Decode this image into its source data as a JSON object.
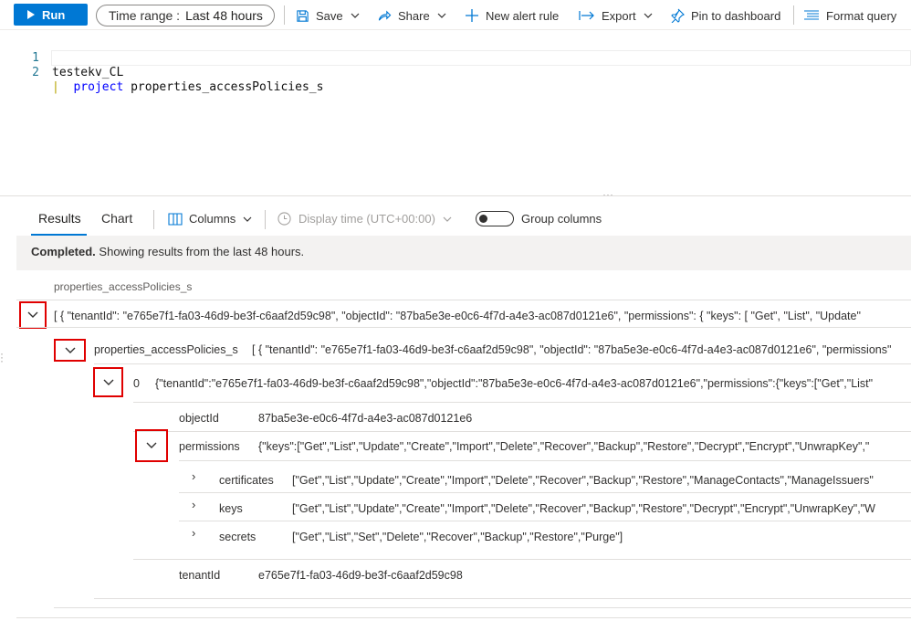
{
  "toolbar": {
    "run_label": "Run",
    "time_range_label": "Time range :",
    "time_range_value": "Last 48 hours",
    "save_label": "Save",
    "share_label": "Share",
    "new_alert_label": "New alert rule",
    "export_label": "Export",
    "pin_label": "Pin to dashboard",
    "format_label": "Format query"
  },
  "editor": {
    "lines": [
      {
        "number": "1",
        "text": "testekv_CL"
      },
      {
        "number": "2",
        "pipe": "|",
        "keyword": "project",
        "text": "properties_accessPolicies_s"
      }
    ]
  },
  "results": {
    "tabs": [
      "Results",
      "Chart"
    ],
    "columns_label": "Columns",
    "display_time_label": "Display time (UTC+00:00)",
    "group_columns_label": "Group columns",
    "status_bold": "Completed.",
    "status_text": "Showing results from the last 48 hours.",
    "column_header": "properties_accessPolicies_s",
    "row_value": "[ { \"tenantId\": \"e765e7f1-fa03-46d9-be3f-c6aaf2d59c98\", \"objectId\": \"87ba5e3e-e0c6-4f7d-a4e3-ac087d0121e6\", \"permissions\": { \"keys\": [ \"Get\", \"List\", \"Update\"",
    "level1": {
      "name": "properties_accessPolicies_s",
      "value": "[ { \"tenantId\": \"e765e7f1-fa03-46d9-be3f-c6aaf2d59c98\", \"objectId\": \"87ba5e3e-e0c6-4f7d-a4e3-ac087d0121e6\", \"permissions\""
    },
    "level2": {
      "name": "0",
      "value": "{\"tenantId\":\"e765e7f1-fa03-46d9-be3f-c6aaf2d59c98\",\"objectId\":\"87ba5e3e-e0c6-4f7d-a4e3-ac087d0121e6\",\"permissions\":{\"keys\":[\"Get\",\"List\""
    },
    "objectId": {
      "name": "objectId",
      "value": "87ba5e3e-e0c6-4f7d-a4e3-ac087d0121e6"
    },
    "permissions": {
      "name": "permissions",
      "value": "{\"keys\":[\"Get\",\"List\",\"Update\",\"Create\",\"Import\",\"Delete\",\"Recover\",\"Backup\",\"Restore\",\"Decrypt\",\"Encrypt\",\"UnwrapKey\",\"",
      "children": [
        {
          "name": "certificates",
          "value": "[\"Get\",\"List\",\"Update\",\"Create\",\"Import\",\"Delete\",\"Recover\",\"Backup\",\"Restore\",\"ManageContacts\",\"ManageIssuers\""
        },
        {
          "name": "keys",
          "value": "[\"Get\",\"List\",\"Update\",\"Create\",\"Import\",\"Delete\",\"Recover\",\"Backup\",\"Restore\",\"Decrypt\",\"Encrypt\",\"UnwrapKey\",\"W"
        },
        {
          "name": "secrets",
          "value": "[\"Get\",\"List\",\"Set\",\"Delete\",\"Recover\",\"Backup\",\"Restore\",\"Purge\"]"
        }
      ]
    },
    "tenantId": {
      "name": "tenantId",
      "value": "e765e7f1-fa03-46d9-be3f-c6aaf2d59c98"
    }
  },
  "colors": {
    "accent": "#0078d4",
    "highlight_border": "#e00000"
  }
}
